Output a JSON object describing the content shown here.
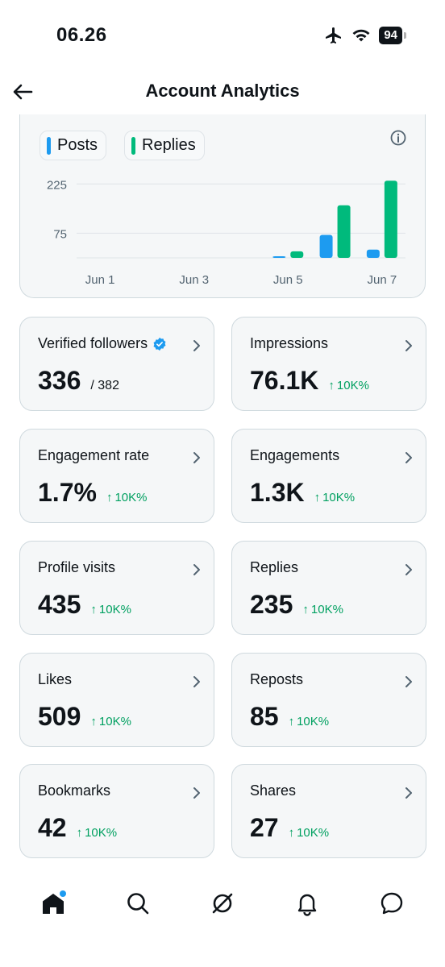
{
  "status_bar": {
    "time": "06.26",
    "battery": "94"
  },
  "header": {
    "title": "Account Analytics"
  },
  "chart": {
    "legend": [
      {
        "label": "Posts",
        "color": "#1d9bf0"
      },
      {
        "label": "Replies",
        "color": "#00ba7c"
      }
    ],
    "y_ticks": [
      "225",
      "75"
    ],
    "x_ticks": [
      "Jun 1",
      "Jun 3",
      "Jun 5",
      "Jun 7"
    ]
  },
  "chart_data": {
    "type": "bar",
    "categories": [
      "Jun 1",
      "Jun 2",
      "Jun 3",
      "Jun 4",
      "Jun 5",
      "Jun 6",
      "Jun 7"
    ],
    "series": [
      {
        "name": "Posts",
        "color": "#1d9bf0",
        "values": [
          0,
          0,
          0,
          0,
          5,
          70,
          25
        ]
      },
      {
        "name": "Replies",
        "color": "#00ba7c",
        "values": [
          0,
          0,
          0,
          0,
          20,
          160,
          235
        ]
      }
    ],
    "yticks": [
      75,
      225
    ],
    "ylim": [
      0,
      260
    ],
    "grid": true
  },
  "metrics": [
    {
      "label": "Verified followers",
      "value": "336",
      "sub": "/ 382",
      "change": "",
      "verified": true
    },
    {
      "label": "Impressions",
      "value": "76.1K",
      "sub": "",
      "change": "10K%"
    },
    {
      "label": "Engagement rate",
      "value": "1.7%",
      "sub": "",
      "change": "10K%"
    },
    {
      "label": "Engagements",
      "value": "1.3K",
      "sub": "",
      "change": "10K%"
    },
    {
      "label": "Profile visits",
      "value": "435",
      "sub": "",
      "change": "10K%"
    },
    {
      "label": "Replies",
      "value": "235",
      "sub": "",
      "change": "10K%"
    },
    {
      "label": "Likes",
      "value": "509",
      "sub": "",
      "change": "10K%"
    },
    {
      "label": "Reposts",
      "value": "85",
      "sub": "",
      "change": "10K%"
    },
    {
      "label": "Bookmarks",
      "value": "42",
      "sub": "",
      "change": "10K%"
    },
    {
      "label": "Shares",
      "value": "27",
      "sub": "",
      "change": "10K%"
    }
  ],
  "change_arrow": "↑",
  "nav": [
    {
      "icon": "home-icon",
      "active": true,
      "dot": true
    },
    {
      "icon": "search-icon"
    },
    {
      "icon": "grok-icon"
    },
    {
      "icon": "bell-icon"
    },
    {
      "icon": "chat-icon"
    }
  ]
}
